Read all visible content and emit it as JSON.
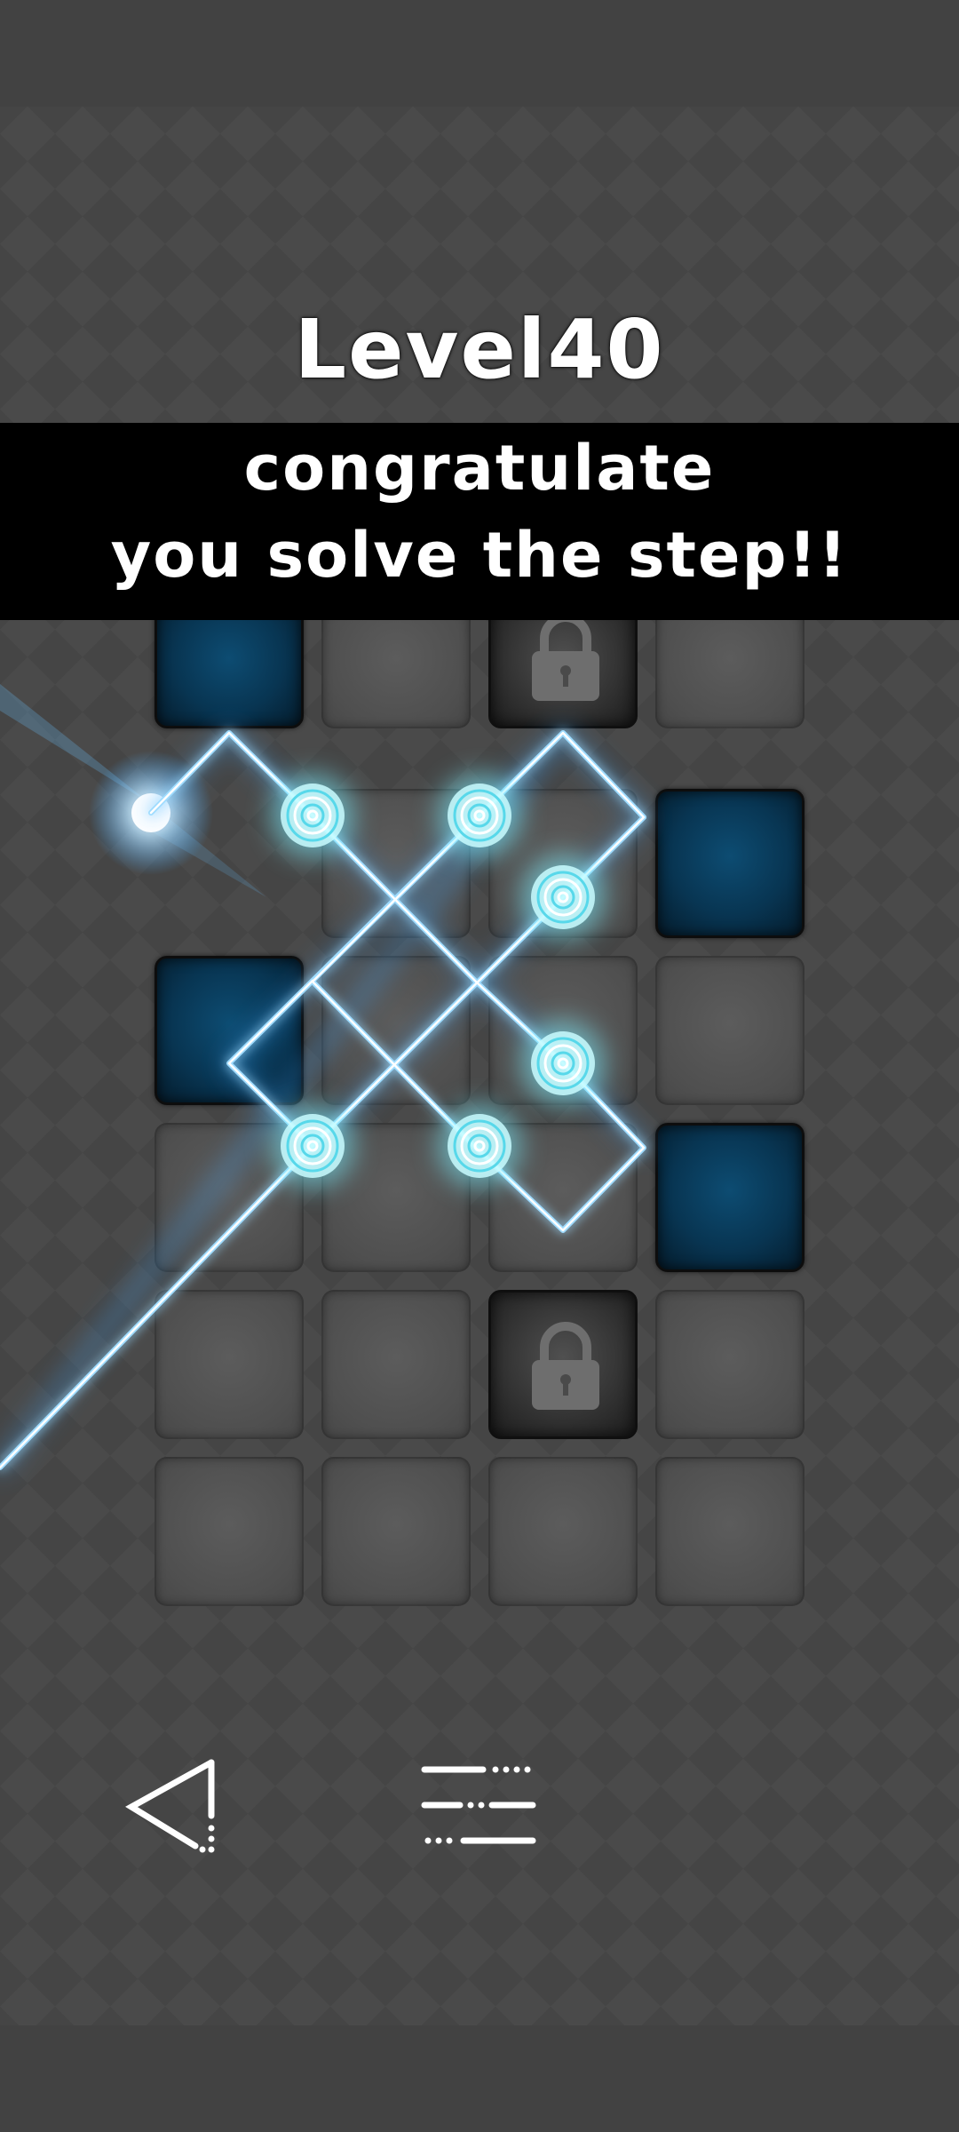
{
  "level": {
    "title": "Level40"
  },
  "banner": {
    "line1": "congratulate",
    "line2": "you solve the step!!"
  },
  "board": {
    "columns": 4,
    "rows": 6,
    "cells": [
      [
        "blue",
        "gray",
        "locked",
        "gray"
      ],
      [
        "empty",
        "gray",
        "gray",
        "blue"
      ],
      [
        "blue",
        "gray",
        "gray",
        "gray"
      ],
      [
        "gray",
        "gray",
        "gray",
        "blue"
      ],
      [
        "gray",
        "gray",
        "locked",
        "gray"
      ],
      [
        "gray",
        "gray",
        "gray",
        "gray"
      ]
    ]
  },
  "icons": {
    "back": "back-triangle-icon",
    "menu": "level-menu-icon",
    "lock": "lock-icon",
    "emitter": "laser-emitter-icon",
    "target": "laser-target-icon"
  },
  "colors": {
    "laser": "#bfeaff",
    "laser_glow": "#3fa9ff",
    "target_glow": "#9ff4ff",
    "blue_tile": "#0a3f60",
    "banner_bg": "#000000",
    "background": "#4a4a4a"
  }
}
